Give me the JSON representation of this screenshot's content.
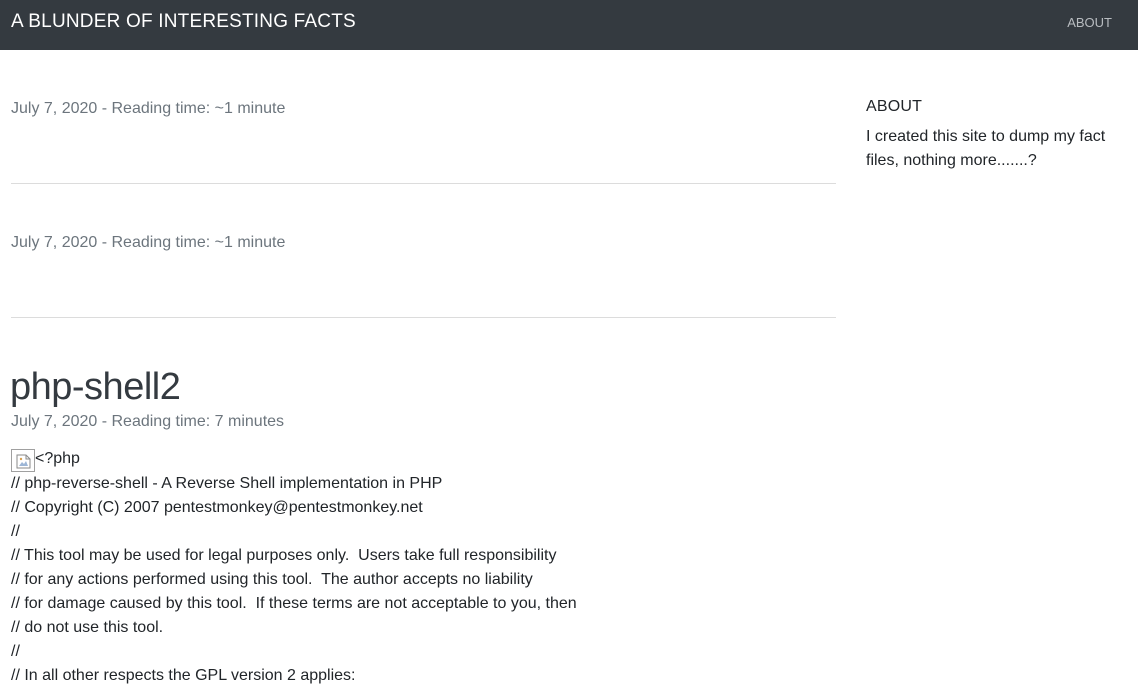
{
  "header": {
    "brand": "A BLUNDER OF INTERESTING FACTS",
    "nav_about": "ABOUT"
  },
  "posts": [
    {
      "meta": "July 7, 2020 - Reading time: ~1 minute"
    },
    {
      "meta": "July 7, 2020 - Reading time: ~1 minute"
    },
    {
      "title": "php-shell2",
      "meta": "July 7, 2020 - Reading time: 7 minutes",
      "body_lines": [
        "<?php",
        "// php-reverse-shell - A Reverse Shell implementation in PHP",
        "// Copyright (C) 2007 pentestmonkey@pentestmonkey.net",
        "//",
        "// This tool may be used for legal purposes only.  Users take full responsibility",
        "// for any actions performed using this tool.  The author accepts no liability",
        "// for damage caused by this tool.  If these terms are not acceptable to you, then",
        "// do not use this tool.",
        "//",
        "// In all other respects the GPL version 2 applies:"
      ],
      "body_icon": "broken-image-icon"
    }
  ],
  "sidebar": {
    "heading": "ABOUT",
    "text": "I created this site to dump my fact files, nothing more.......?"
  }
}
